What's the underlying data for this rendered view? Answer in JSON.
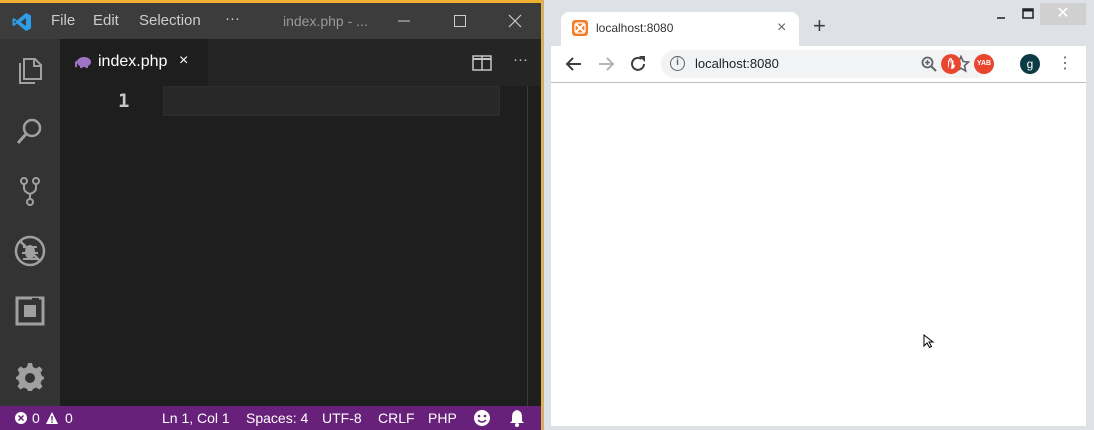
{
  "vscode": {
    "menu": [
      "File",
      "Edit",
      "Selection"
    ],
    "menu_more": "···",
    "title": "index.php - ...",
    "tab": {
      "label": "index.php",
      "close": "×"
    },
    "line_number": "1",
    "editor_more": "···",
    "status": {
      "errors": "0",
      "warnings": "0",
      "position": "Ln 1, Col 1",
      "spaces": "Spaces: 4",
      "encoding": "UTF-8",
      "eol": "CRLF",
      "language": "PHP"
    },
    "accent": "#68217a"
  },
  "chrome": {
    "tab_title": "localhost:8080",
    "tab_close": "×",
    "new_tab": "+",
    "url": "localhost:8080",
    "ext_yab": "YAB",
    "avatar": "g",
    "win_close": "✕"
  }
}
